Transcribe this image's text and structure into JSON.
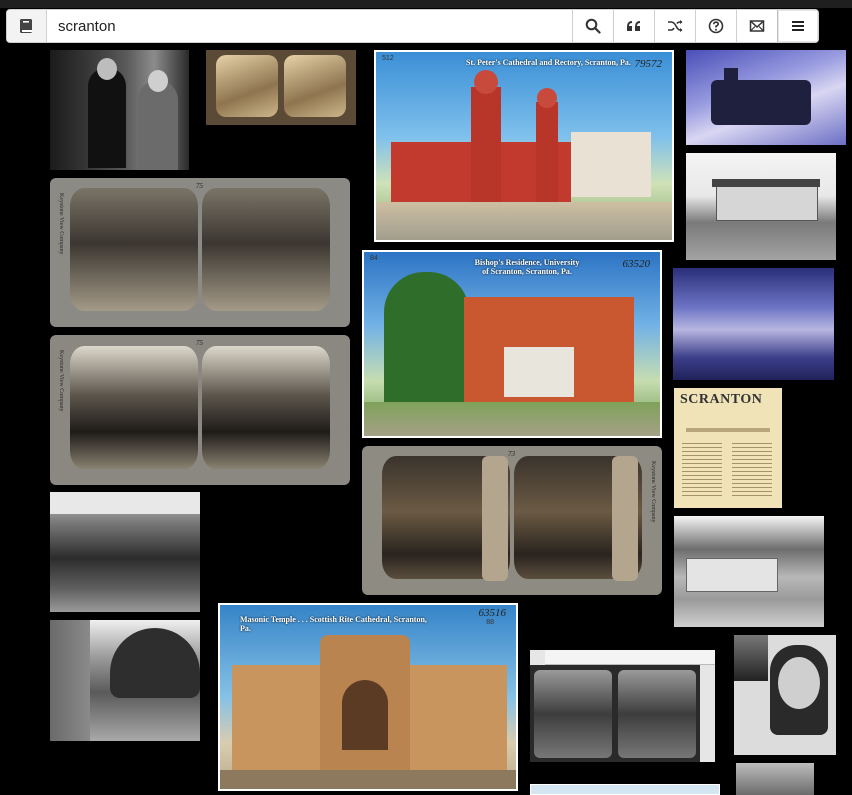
{
  "search": {
    "value": "scranton"
  },
  "toolbar": {
    "buttons": [
      {
        "name": "search-button",
        "icon": "search-icon"
      },
      {
        "name": "quote-button",
        "icon": "quote-icon"
      },
      {
        "name": "shuffle-button",
        "icon": "shuffle-icon"
      },
      {
        "name": "help-button",
        "icon": "help-icon"
      },
      {
        "name": "mail-button",
        "icon": "mail-icon"
      },
      {
        "name": "menu-button",
        "icon": "hamburger-icon"
      }
    ]
  },
  "results": {
    "stpeters": {
      "caption": "St. Peter's Cathedral and Rectory, Scranton, Pa.",
      "number": "79572",
      "pub_number": "512"
    },
    "bishops": {
      "caption": "Bishop's Residence, University of Scranton, Scranton, Pa.",
      "number": "63520",
      "pub_number": "84"
    },
    "masonic": {
      "caption": "Masonic Temple . . . Scottish Rite Cathedral, Scranton, Pa.",
      "number": "63516",
      "pub_number": "88"
    },
    "stereo_breaker": {
      "number": "75",
      "side_text": "Keystone View Company"
    },
    "stereo_mine": {
      "number": "75",
      "side_text": "Keystone View Company"
    },
    "stereo_underground": {
      "number": "73",
      "side_text": "Keystone View Company"
    },
    "directory": {
      "title": "SCRANTON"
    }
  }
}
